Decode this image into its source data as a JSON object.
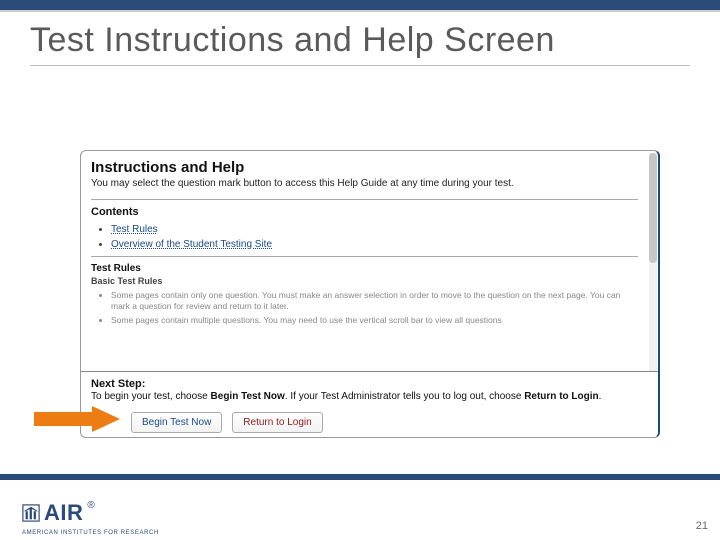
{
  "slide": {
    "title": "Test Instructions and Help Screen",
    "page_number": "21"
  },
  "logo": {
    "short": "AIR",
    "reg": "®",
    "sub": "AMERICAN INSTITUTES FOR RESEARCH"
  },
  "app": {
    "heading": "Instructions and Help",
    "subtext": "You may select the question mark button to access this Help Guide at any time during your test.",
    "contents_label": "Contents",
    "toc": [
      {
        "label": "Test Rules"
      },
      {
        "label": "Overview of the Student Testing Site"
      }
    ],
    "rules_heading": "Test Rules",
    "basic_heading": "Basic Test Rules",
    "rules": [
      "Some pages contain only one question. You must make an answer selection in order to move to the question on the next page. You can mark a question for review and return to it later.",
      "Some pages contain multiple questions. You may need to use the vertical scroll bar to view all questions"
    ],
    "next_step_label": "Next Step:",
    "next_step_text_1": "To begin your test, choose ",
    "next_step_bold_1": "Begin Test Now",
    "next_step_text_2": ". If your Test Administrator tells you to log out, choose ",
    "next_step_bold_2": "Return to Login",
    "next_step_text_3": ".",
    "begin_btn": "Begin Test Now",
    "return_btn": "Return to Login"
  }
}
